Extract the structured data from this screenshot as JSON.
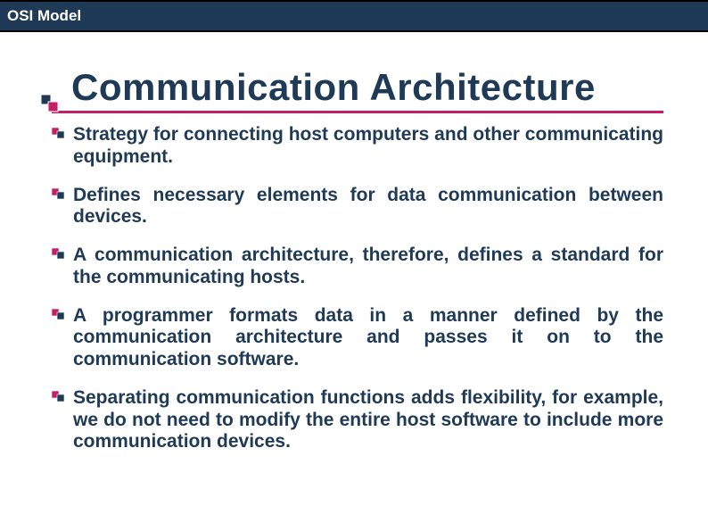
{
  "header": {
    "title": "OSI Model"
  },
  "slide": {
    "title": "Communication Architecture",
    "bullets": [
      "Strategy for connecting host computers and other communicating equipment.",
      "Defines necessary elements for data communication between devices.",
      "A communication architecture, therefore, defines a standard for the communicating hosts.",
      "A programmer formats data in a manner defined by the communication architecture and passes it on to the communication software.",
      "Separating communication functions adds flexibility, for example, we do not need to modify the entire host software to include more communication devices."
    ]
  }
}
